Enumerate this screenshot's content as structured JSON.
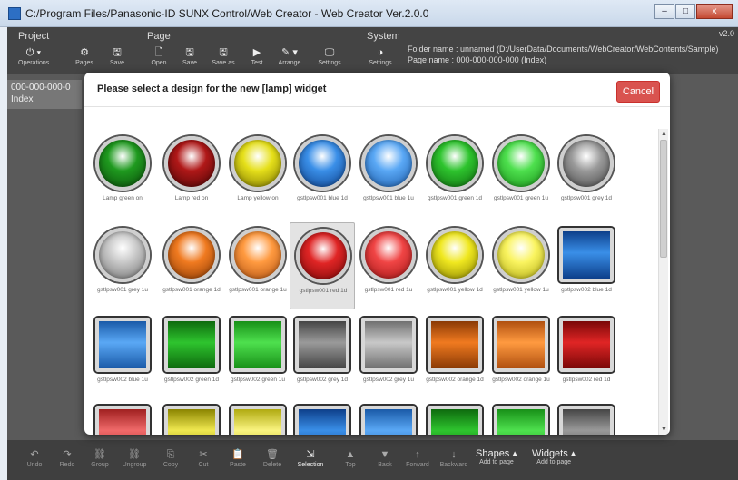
{
  "window": {
    "title": "C:/Program Files/Panasonic-ID SUNX Control/Web Creator - Web Creator Ver.2.0.0",
    "minimize": "–",
    "maximize": "□",
    "close": "x"
  },
  "toolbar": {
    "groups": [
      {
        "title": "Project",
        "buttons": [
          {
            "icon": "⏻ ▾",
            "label": "Operations"
          },
          {
            "icon": "⚙",
            "label": "Pages"
          },
          {
            "icon": "🖫",
            "label": "Save"
          }
        ]
      },
      {
        "title": "Page",
        "buttons": [
          {
            "icon": "🗋",
            "label": "Open"
          },
          {
            "icon": "🖫",
            "label": "Save"
          },
          {
            "icon": "🖫",
            "label": "Save as"
          },
          {
            "icon": "▶",
            "label": "Test"
          },
          {
            "icon": "✎ ▾",
            "label": "Arrange"
          },
          {
            "icon": "🖵",
            "label": "Settings"
          }
        ]
      },
      {
        "title": "System",
        "buttons": [
          {
            "icon": "◑",
            "label": "Settings"
          }
        ]
      }
    ],
    "folder_name_line": "Folder name : unnamed (D:/UserData/Documents/WebCreator/WebContents/Sample)",
    "page_name_line": "Page name : 000-000-000-000 (Index)",
    "version": "v2.0"
  },
  "page_list": {
    "item_id": "000-000-000-0",
    "item_name": "Index"
  },
  "modal": {
    "title": "Please select a design for the new [lamp] widget",
    "cancel_label": "Cancel",
    "widgets": [
      {
        "label": "Lamp green on",
        "shape": "round",
        "color": "#1f9a1f",
        "dark": "#0a4a0a",
        "selected": false
      },
      {
        "label": "Lamp red on",
        "shape": "round",
        "color": "#b01818",
        "dark": "#4a0505",
        "selected": false
      },
      {
        "label": "Lamp yellow on",
        "shape": "round",
        "color": "#e6e01a",
        "dark": "#7a7400",
        "selected": false
      },
      {
        "label": "gstlpsw001 blue 1d",
        "shape": "round",
        "color": "#3a8fe8",
        "dark": "#0d3f8a",
        "selected": false
      },
      {
        "label": "gstlpsw001 blue 1u",
        "shape": "round",
        "color": "#5aa8f5",
        "dark": "#1a5aa8",
        "selected": false
      },
      {
        "label": "gstlpsw001 green 1d",
        "shape": "round",
        "color": "#2ec42e",
        "dark": "#0e6a0e",
        "selected": false
      },
      {
        "label": "gstlpsw001 green 1u",
        "shape": "round",
        "color": "#4ee04e",
        "dark": "#189018",
        "selected": false
      },
      {
        "label": "gstlpsw001 grey 1d",
        "shape": "round",
        "color": "#9a9a9a",
        "dark": "#454545",
        "selected": false
      },
      {
        "label": "gstlpsw001 grey 1u",
        "shape": "round",
        "color": "#c8c8c8",
        "dark": "#707070",
        "selected": false
      },
      {
        "label": "gstlpsw001 orange 1d",
        "shape": "round",
        "color": "#f07a20",
        "dark": "#8a3a05",
        "selected": false
      },
      {
        "label": "gstlpsw001 orange 1u",
        "shape": "round",
        "color": "#ff9a40",
        "dark": "#b05010",
        "selected": false
      },
      {
        "label": "gstlpsw001 red 1d",
        "shape": "round",
        "color": "#e02525",
        "dark": "#7a0808",
        "selected": true
      },
      {
        "label": "gstlpsw001 red 1u",
        "shape": "round",
        "color": "#f04545",
        "dark": "#a01515",
        "selected": false
      },
      {
        "label": "gstlpsw001 yellow 1d",
        "shape": "round",
        "color": "#f0e820",
        "dark": "#8a8400",
        "selected": false
      },
      {
        "label": "gstlpsw001 yellow 1u",
        "shape": "round",
        "color": "#faf460",
        "dark": "#b0aa10",
        "selected": false
      },
      {
        "label": "gstlpsw002 blue 1d",
        "shape": "square",
        "color": "#3a8fe8",
        "dark": "#0d3f8a",
        "selected": false
      },
      {
        "label": "gstlpsw002 blue 1u",
        "shape": "square",
        "color": "#5aa8f5",
        "dark": "#1a5aa8",
        "selected": false
      },
      {
        "label": "gstlpsw002 green 1d",
        "shape": "square",
        "color": "#2ec42e",
        "dark": "#0e6a0e",
        "selected": false
      },
      {
        "label": "gstlpsw002 green 1u",
        "shape": "square",
        "color": "#4ee04e",
        "dark": "#189018",
        "selected": false
      },
      {
        "label": "gstlpsw002 grey 1d",
        "shape": "square",
        "color": "#9a9a9a",
        "dark": "#454545",
        "selected": false
      },
      {
        "label": "gstlpsw002 grey 1u",
        "shape": "square",
        "color": "#c8c8c8",
        "dark": "#707070",
        "selected": false
      },
      {
        "label": "gstlpsw002 orange 1d",
        "shape": "square",
        "color": "#f07a20",
        "dark": "#8a3a05",
        "selected": false
      },
      {
        "label": "gstlpsw002 orange 1u",
        "shape": "square",
        "color": "#ff9a40",
        "dark": "#b05010",
        "selected": false
      },
      {
        "label": "gstlpsw002 red 1d",
        "shape": "square",
        "color": "#e02525",
        "dark": "#7a0808",
        "selected": false
      },
      {
        "label": "",
        "shape": "square",
        "color": "#f06a6a",
        "dark": "#a02020",
        "selected": false
      },
      {
        "label": "",
        "shape": "square",
        "color": "#f0e850",
        "dark": "#8a8400",
        "selected": false
      },
      {
        "label": "",
        "shape": "square",
        "color": "#faf480",
        "dark": "#b0aa10",
        "selected": false
      },
      {
        "label": "",
        "shape": "square",
        "color": "#3a8fe8",
        "dark": "#0d3f8a",
        "selected": false
      },
      {
        "label": "",
        "shape": "square",
        "color": "#5aa8f5",
        "dark": "#1a5aa8",
        "selected": false
      },
      {
        "label": "",
        "shape": "square",
        "color": "#2ec42e",
        "dark": "#0e6a0e",
        "selected": false
      },
      {
        "label": "",
        "shape": "square",
        "color": "#4ee04e",
        "dark": "#189018",
        "selected": false
      },
      {
        "label": "",
        "shape": "square",
        "color": "#9a9a9a",
        "dark": "#454545",
        "selected": false
      }
    ]
  },
  "bottombar": {
    "buttons": [
      {
        "icon": "↶",
        "label": "Undo",
        "active": false
      },
      {
        "icon": "↷",
        "label": "Redo",
        "active": false
      },
      {
        "icon": "⛓",
        "label": "Group",
        "active": false
      },
      {
        "icon": "⛓",
        "label": "Ungroup",
        "active": false
      },
      {
        "icon": "⎘",
        "label": "Copy",
        "active": false
      },
      {
        "icon": "✂",
        "label": "Cut",
        "active": false
      },
      {
        "icon": "📋",
        "label": "Paste",
        "active": false
      },
      {
        "icon": "🗑",
        "label": "Delete",
        "active": false
      },
      {
        "icon": "⇲",
        "label": "Selection",
        "active": true
      },
      {
        "icon": "▲",
        "label": "Top",
        "active": false
      },
      {
        "icon": "▼",
        "label": "Back",
        "active": false
      },
      {
        "icon": "↑",
        "label": "Forward",
        "active": false
      },
      {
        "icon": "↓",
        "label": "Backward",
        "active": false
      }
    ],
    "shapes_label": "Shapes ▴",
    "shapes_sub": "Add to page",
    "widgets_label": "Widgets ▴",
    "widgets_sub": "Add to page"
  }
}
